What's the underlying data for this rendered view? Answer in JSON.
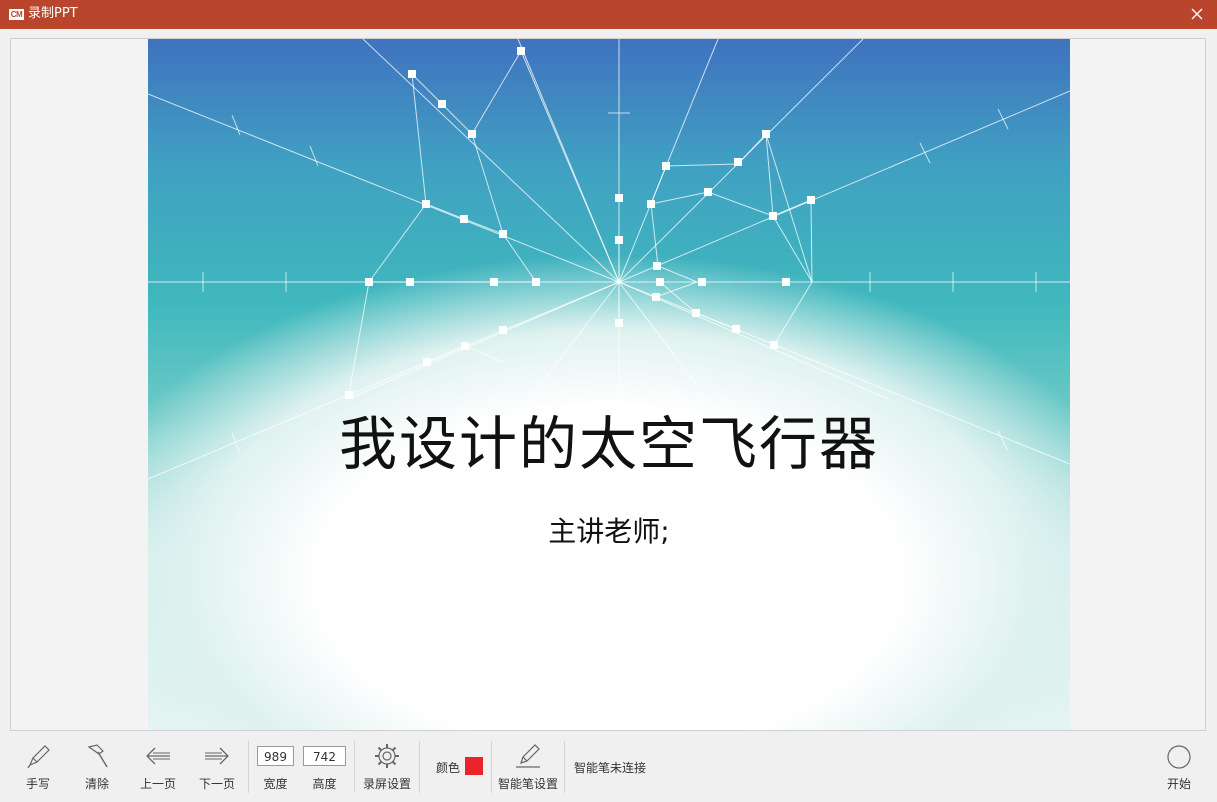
{
  "window": {
    "logo_text": "CM",
    "title": "录制PPT"
  },
  "slide": {
    "title": "我设计的太空飞行器",
    "subtitle": "主讲老师;"
  },
  "toolbar": {
    "handwrite_label": "手写",
    "clear_label": "清除",
    "prev_label": "上一页",
    "next_label": "下一页",
    "width_value": "989",
    "width_label": "宽度",
    "height_value": "742",
    "height_label": "高度",
    "screen_settings_label": "录屏设置",
    "color_label": "颜色",
    "color_value": "#e8232a",
    "pen_settings_label": "智能笔设置",
    "pen_status": "智能笔未连接",
    "start_label": "开始"
  }
}
